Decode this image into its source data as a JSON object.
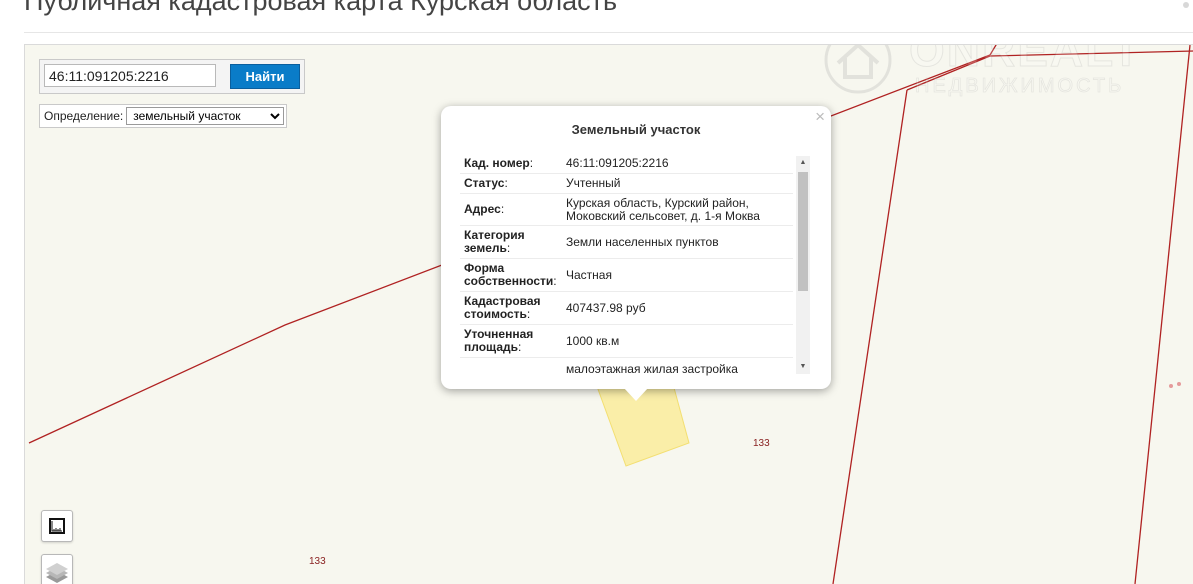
{
  "header": {
    "title": "Публичная кадастровая карта Курская область"
  },
  "watermark": {
    "brand": "ONREALT",
    "subtitle": "НЕДВИЖИМОСТЬ"
  },
  "search": {
    "value": "46:11:091205:2216",
    "button_label": "Найти"
  },
  "definition": {
    "label": "Определение:",
    "selected": "земельный участок"
  },
  "map": {
    "parcel_numbers": [
      "133",
      "133"
    ],
    "boundary_color": "#b02222",
    "highlight_color": "#fbeb90"
  },
  "tools": {
    "ruler_icon": "ruler-icon",
    "layers_icon": "layers-icon"
  },
  "popup": {
    "close": "×",
    "title": "Земельный участок",
    "rows": [
      {
        "label": "Кад. номер",
        "value": "46:11:091205:2216"
      },
      {
        "label": "Статус",
        "value": "Учтенный"
      },
      {
        "label": "Адрес",
        "value": "Курская область, Курский район, Моковский сельсовет, д. 1-я Моква"
      },
      {
        "label": "Категория земель",
        "value": "Земли населенных пунктов"
      },
      {
        "label": "Форма собственности",
        "value": "Частная"
      },
      {
        "label": "Кадастровая стоимость",
        "value": "407437.98 руб"
      },
      {
        "label": "Уточненная площадь",
        "value": "1000 кв.м"
      },
      {
        "label": "",
        "value": "малоэтажная жилая застройка"
      }
    ]
  }
}
